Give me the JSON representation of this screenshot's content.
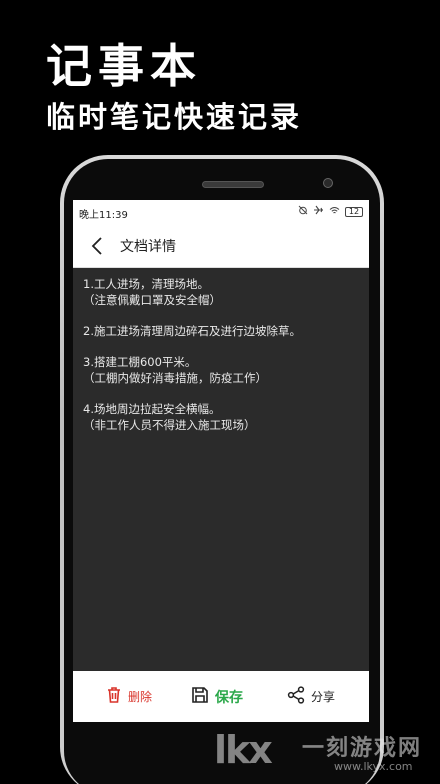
{
  "promo": {
    "title": "记事本",
    "subtitle": "临时笔记快速记录"
  },
  "status_bar": {
    "time": "晚上11:39",
    "battery": "12"
  },
  "app_bar": {
    "title": "文档详情",
    "back_icon": "chevron-left-icon"
  },
  "note": {
    "paragraphs": [
      {
        "line1": "1.工人进场，清理场地。",
        "line2": "（注意佩戴口罩及安全帽）"
      },
      {
        "line1": "2.施工进场清理周边碎石及进行边坡除草。",
        "line2": ""
      },
      {
        "line1": "3.搭建工棚600平米。",
        "line2": "（工棚内做好消毒措施，防疫工作）"
      },
      {
        "line1": "4.场地周边拉起安全横幅。",
        "line2": "（非工作人员不得进入施工现场）"
      }
    ]
  },
  "toolbar": {
    "delete_label": "删除",
    "save_label": "保存",
    "share_label": "分享",
    "delete_color": "#d9342b",
    "save_color": "#2ba84a"
  },
  "watermark": {
    "logo": "lkx",
    "text": "一刻游戏网",
    "url": "www.lkyx.com"
  }
}
